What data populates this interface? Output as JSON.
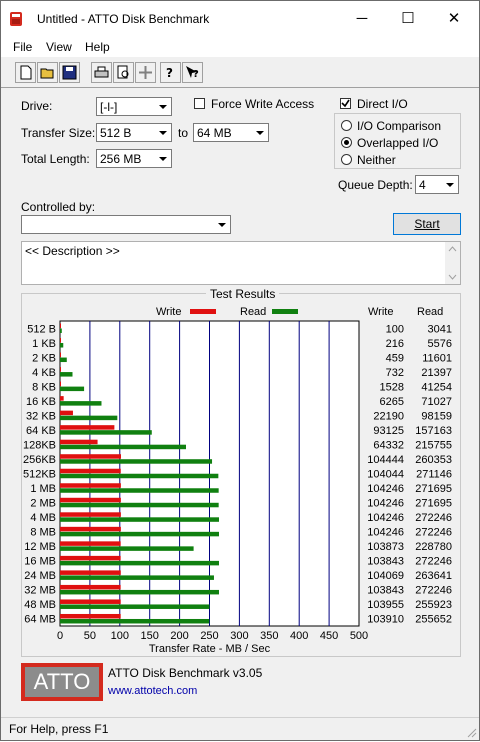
{
  "window": {
    "title": "Untitled - ATTO Disk Benchmark",
    "minimize": "─",
    "maximize": "☐",
    "close": "✕"
  },
  "menu": [
    "File",
    "View",
    "Help"
  ],
  "toolbar": {
    "icons": [
      "new-icon",
      "open-icon",
      "save-icon",
      "print-icon",
      "print-preview-icon",
      "move-icon",
      "help-icon",
      "context-help-icon"
    ]
  },
  "settings": {
    "drive_label": "Drive:",
    "drive_value": "[-l-]",
    "force_write_label": "Force Write Access",
    "force_write_checked": false,
    "direct_io_label": "Direct I/O",
    "direct_io_checked": true,
    "transfer_size_label": "Transfer Size:",
    "transfer_from": "512 B",
    "to_label": "to",
    "transfer_to": "64 MB",
    "total_length_label": "Total Length:",
    "total_length": "256 MB",
    "io_comparison": "I/O Comparison",
    "overlapped_io": "Overlapped I/O",
    "neither": "Neither",
    "selected_mode": "Overlapped I/O",
    "queue_depth_label": "Queue Depth:",
    "queue_depth": "4",
    "controlled_by_label": "Controlled by:",
    "controlled_by_value": "",
    "start_button": "Start",
    "description": "<< Description >>"
  },
  "results": {
    "group_title": "Test Results",
    "legend_write": "Write",
    "legend_read": "Read",
    "col_write": "Write",
    "col_read": "Read",
    "axis_title": "Transfer Rate - MB / Sec"
  },
  "chart_data": {
    "type": "bar",
    "orientation": "horizontal",
    "title": "Test Results",
    "xlabel": "Transfer Rate - MB / Sec",
    "xlim": [
      0,
      500
    ],
    "xticks": [
      0,
      50,
      100,
      150,
      200,
      250,
      300,
      350,
      400,
      450,
      500
    ],
    "categories": [
      "512 B",
      "1 KB",
      "2 KB",
      "4 KB",
      "8 KB",
      "16 KB",
      "32 KB",
      "64 KB",
      "128KB",
      "256KB",
      "512KB",
      "1 MB",
      "2 MB",
      "4 MB",
      "8 MB",
      "12 MB",
      "16 MB",
      "24 MB",
      "32 MB",
      "48 MB",
      "64 MB"
    ],
    "series": [
      {
        "name": "Write",
        "color": "#e01010",
        "values": [
          100,
          216,
          459,
          732,
          1528,
          6265,
          22190,
          93125,
          64332,
          104444,
          104044,
          104246,
          104246,
          104246,
          104246,
          103873,
          103843,
          104069,
          103843,
          103955,
          103910
        ]
      },
      {
        "name": "Read",
        "color": "#108010",
        "values": [
          3041,
          5576,
          11601,
          21397,
          41254,
          71027,
          98159,
          157163,
          215755,
          260353,
          271146,
          271695,
          271695,
          272246,
          272246,
          228780,
          272246,
          263641,
          272246,
          255923,
          255652
        ]
      }
    ],
    "values_unit": "KB/s",
    "grid": true
  },
  "footer": {
    "logo_text": "ATTO",
    "product": "ATTO Disk Benchmark v3.05",
    "link": "www.attotech.com"
  },
  "status": "For Help, press F1",
  "colors": {
    "write": "#e01010",
    "read": "#108010",
    "grid": "#000080",
    "logo_red": "#d42a1e",
    "logo_gray": "#8c8c8c",
    "link": "#0000aa"
  }
}
